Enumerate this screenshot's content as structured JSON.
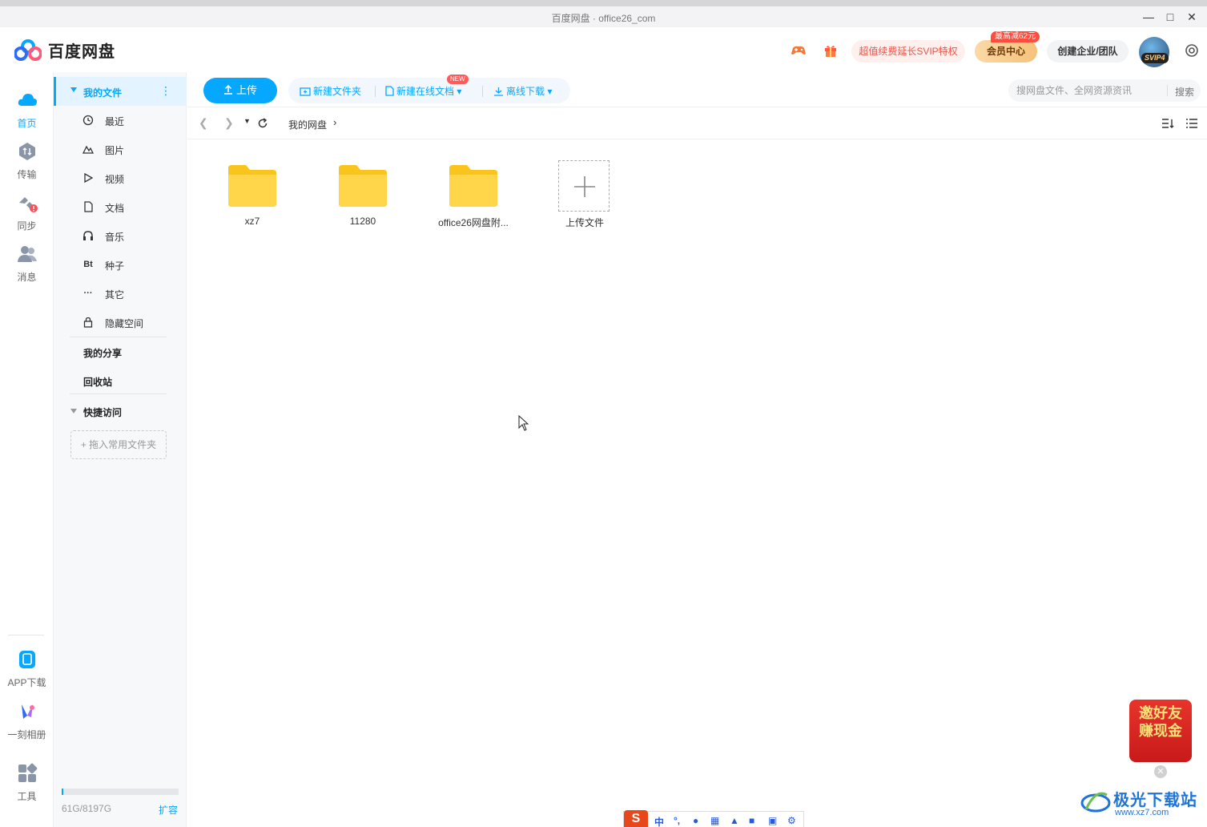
{
  "window": {
    "title": "百度网盘 · office26_com"
  },
  "header": {
    "brand": "百度网盘",
    "svip_promo": "超值续费延长SVIP特权",
    "member_center": "会员中心",
    "member_tag": "最高减62元",
    "team_button": "创建企业/团队",
    "avatar_badge": "SVIP4"
  },
  "rail": {
    "items": [
      {
        "label": "首页",
        "icon": "cloud-icon"
      },
      {
        "label": "传输",
        "icon": "transfer-icon"
      },
      {
        "label": "同步",
        "icon": "sync-icon"
      },
      {
        "label": "消息",
        "icon": "message-icon"
      }
    ],
    "bottom": [
      {
        "label": "APP下载",
        "icon": "phone-icon"
      },
      {
        "label": "一刻相册",
        "icon": "album-icon"
      },
      {
        "label": "工具",
        "icon": "tools-icon"
      }
    ],
    "accent": "#06a7ff"
  },
  "sidebar": {
    "my_files": "我的文件",
    "items": [
      {
        "label": "最近",
        "icon": "clock-icon"
      },
      {
        "label": "图片",
        "icon": "image-icon"
      },
      {
        "label": "视频",
        "icon": "play-icon"
      },
      {
        "label": "文档",
        "icon": "document-icon"
      },
      {
        "label": "音乐",
        "icon": "headphones-icon"
      },
      {
        "label": "种子",
        "icon": "bt-icon",
        "glyph": "Bt"
      },
      {
        "label": "其它",
        "icon": "more-icon",
        "glyph": "···"
      },
      {
        "label": "隐藏空间",
        "icon": "lock-icon"
      }
    ],
    "my_share": "我的分享",
    "recycle": "回收站",
    "quick_access": "快捷访问",
    "drop_hint": "+ 拖入常用文件夹",
    "quota_text": "61G/8197G",
    "quota_fraction": 0.0074,
    "expand": "扩容"
  },
  "toolbar": {
    "upload": "上传",
    "new_folder": "新建文件夹",
    "new_online_doc": "新建在线文档",
    "new_tag": "NEW",
    "offline_download": "离线下载",
    "search_placeholder": "搜网盘文件、全网资源资讯",
    "search_button": "搜索"
  },
  "navbar": {
    "breadcrumb": "我的网盘"
  },
  "files": [
    {
      "name": "xz7",
      "type": "folder"
    },
    {
      "name": "11280",
      "type": "folder"
    },
    {
      "name": "office26网盘附...",
      "type": "folder"
    },
    {
      "name": "上传文件",
      "type": "upload"
    }
  ],
  "promo": {
    "line1": "邀好友",
    "line2": "赚现金"
  },
  "ime": {
    "logo": "S",
    "mode": "中"
  },
  "watermark": {
    "name": "极光下载站",
    "url": "www.xz7.com"
  }
}
